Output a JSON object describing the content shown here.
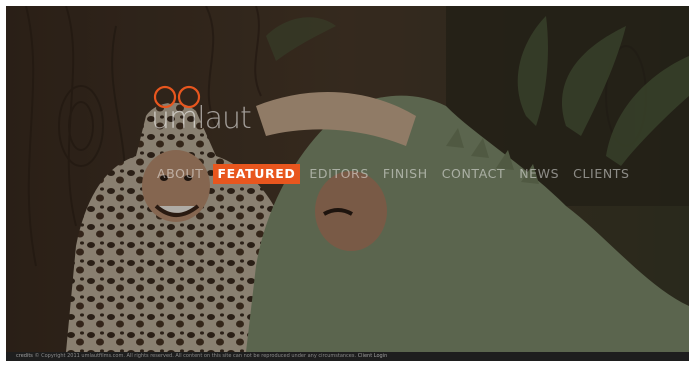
{
  "brand": {
    "name": "umlaut",
    "accent_color": "#e8561e"
  },
  "nav": {
    "items": [
      {
        "label": "ABOUT",
        "active": false
      },
      {
        "label": "FEATURED",
        "active": true
      },
      {
        "label": "EDITORS",
        "active": false
      },
      {
        "label": "FINISH",
        "active": false
      },
      {
        "label": "CONTACT",
        "active": false
      },
      {
        "label": "NEWS",
        "active": false
      },
      {
        "label": "CLIENTS",
        "active": false
      }
    ]
  },
  "footer": {
    "credits_label": "credits",
    "copyright": "© Copyright 2011 umlautfilms.com. All rights reserved. All content on this site can not be reproduced under any circumstances.",
    "client_login_label": "Client Login"
  }
}
